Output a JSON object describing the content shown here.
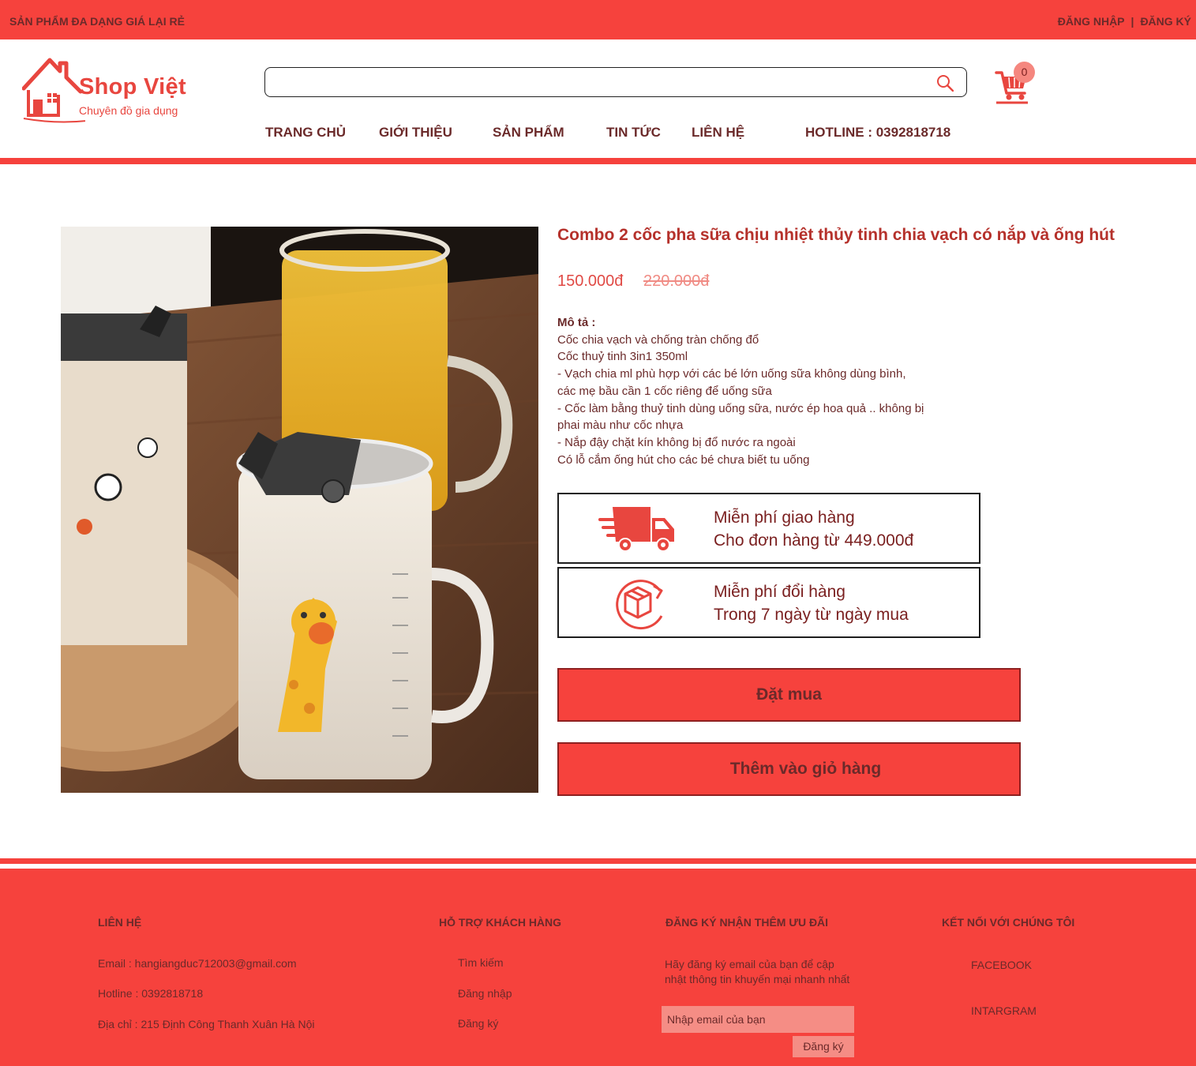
{
  "topbar": {
    "slogan": "SẢN PHẨM ĐA DẠNG GIÁ LẠI RẺ",
    "login": "ĐĂNG NHẬP",
    "separator": "|",
    "register": "ĐĂNG KÝ"
  },
  "brand": {
    "name": "Shop Việt",
    "tagline": "Chuyên đồ gia dụng"
  },
  "search": {
    "value": "",
    "placeholder": ""
  },
  "cart": {
    "count": "0"
  },
  "nav": {
    "home": "TRANG CHỦ",
    "about": "GIỚI THIỆU",
    "products": "SẢN PHẨM",
    "news": "TIN TỨC",
    "contact": "LIÊN HỆ",
    "hotline": "HOTLINE : 0392818718"
  },
  "product": {
    "title": "Combo 2 cốc pha sữa chịu nhiệt thủy tinh chia vạch có nắp và ống hút",
    "price": "150.000đ",
    "old_price": "220.000đ",
    "desc_heading": "Mô tả :",
    "desc_lines": [
      "Cốc chia vạch và chống tràn chống đổ",
      "Cốc thuỷ tinh 3in1 350ml",
      "- Vạch chia ml phù hợp với các bé lớn uống sữa không dùng bình,",
      "các mẹ bầu cần 1 cốc riêng để uống sữa",
      "- Cốc làm bằng thuỷ tinh dùng uống sữa, nước ép hoa quả .. không bị",
      "phai màu như cốc nhựa",
      "- Nắp đậy chặt kín không bị đổ nước ra ngoài",
      "Có lỗ cắm ống hút cho các bé chưa biết tu uống"
    ]
  },
  "benefits": [
    {
      "icon": "delivery-truck-icon",
      "line1": "Miễn phí giao hàng",
      "line2": "Cho đơn hàng từ 449.000đ"
    },
    {
      "icon": "return-box-icon",
      "line1": "Miễn phí đổi hàng",
      "line2": "Trong 7 ngày từ ngày mua"
    }
  ],
  "actions": {
    "buy": "Đặt mua",
    "add_to_cart": "Thêm vào giỏ hàng"
  },
  "footer": {
    "contact": {
      "heading": "LIÊN HỆ",
      "email": "Email : hangiangduc712003@gmail.com",
      "hotline": "Hotline : 0392818718",
      "address": "Địa chỉ : 215 Định Công Thanh Xuân Hà Nội"
    },
    "support": {
      "heading": "HỖ TRỢ KHÁCH HÀNG",
      "search": "Tìm kiếm",
      "login": "Đăng  nhập",
      "register": "Đăng ký"
    },
    "newsletter": {
      "heading": "ĐĂNG KÝ NHẬN THÊM ƯU ĐÃI",
      "text": "Hãy đăng ký email của bạn để cập nhật thông tin khuyến mại nhanh nhất",
      "placeholder": "Nhập email của bạn",
      "button": "Đăng ký"
    },
    "social": {
      "heading": "KẾT NỐI VỚI CHÚNG TÔI",
      "facebook": "FACEBOOK",
      "instagram": "INTARGRAM"
    }
  },
  "colors": {
    "primary": "#f6423d",
    "text": "#6b2a2a",
    "title": "#b5312b",
    "light": "#f58d85"
  }
}
